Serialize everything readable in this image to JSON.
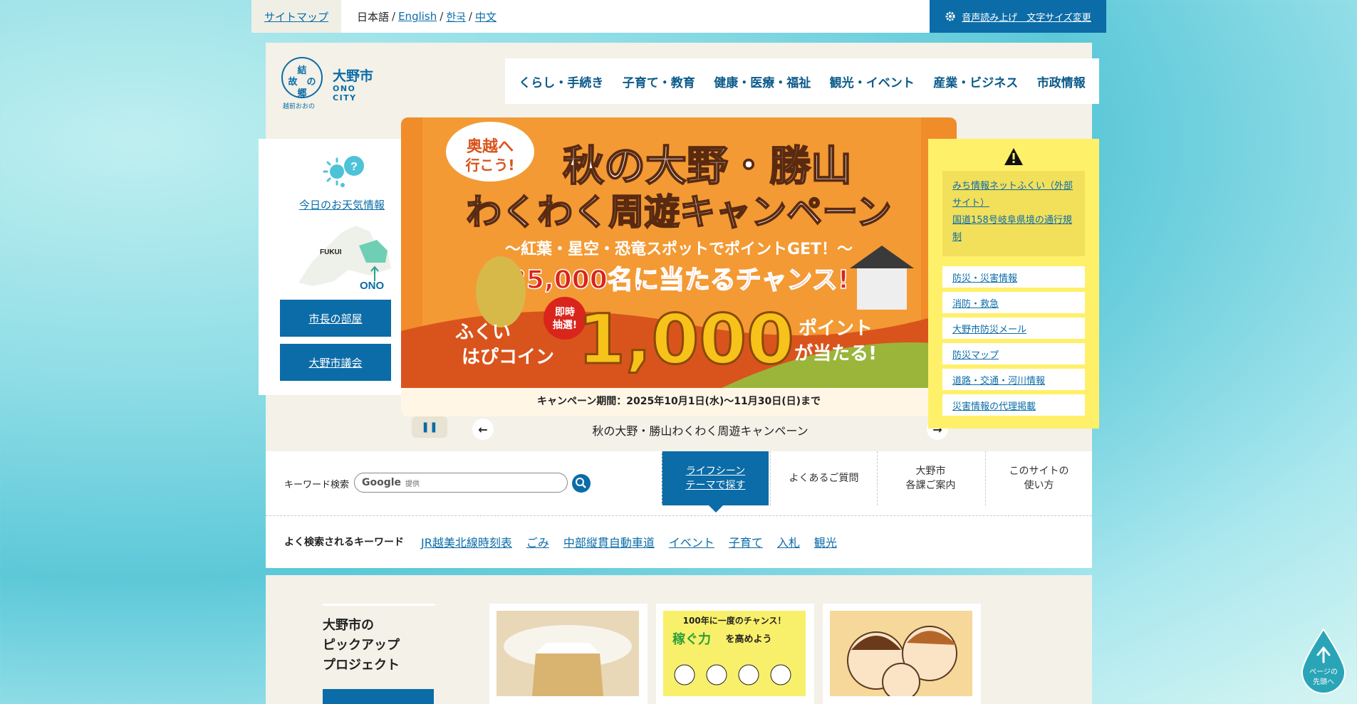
{
  "topbar": {
    "sitemap": "サイトマップ",
    "lang_current": "日本語",
    "langs": [
      "English",
      "한국",
      "中文"
    ],
    "assist": "音声読み上げ　文字サイズ変更"
  },
  "logo": {
    "seal": "結\n故　の\n郷",
    "sub": "越前おおの",
    "name_ja": "大野市",
    "name_en": "ONO CITY"
  },
  "gnav": [
    "くらし・手続き",
    "子育て・教育",
    "健康・医療・福祉",
    "観光・イベント",
    "産業・ビジネス",
    "市政情報"
  ],
  "left": {
    "weather": "今日のお天気情報",
    "map_fukui": "FUKUI",
    "map_ono": "ONO",
    "mayor": "市長の部屋",
    "council": "大野市議会"
  },
  "banner": {
    "tag": "奥越へ\n行こう!",
    "title_1": "秋の大野・勝山",
    "title_2": "わくわく周遊キャンペーン",
    "sub": "〜紅葉・星空・恐竜スポットでポイントGET！〜",
    "chance": "35,000名に当たるチャンス!",
    "instant": "即時\n抽選!",
    "coin": "ふくい\nはぴコイン",
    "points": "1,000",
    "points_tail": "ポイント\nが当たる!",
    "period": "キャンペーン期間：2025年10月1日(水)〜11月30日(日)まで",
    "caption": "秋の大野・勝山わくわく周遊キャンペーン"
  },
  "warn": {
    "notice_1": "みち情報ネットふくい（外部サイト）",
    "notice_2": "国道158号岐阜県境の通行規制",
    "items": [
      "防災・災害情報",
      "消防・救急",
      "大野市防災メール",
      "防災マップ",
      "道路・交通・河川情報",
      "災害情報の代理掲載"
    ]
  },
  "search": {
    "label": "キーワード検索",
    "google": "Google",
    "provided": "提供",
    "tab_life": "ライフシーン\nテーマで探す",
    "tab_faq": "よくあるご質問",
    "tab_dept": "大野市\n各課ご案内",
    "tab_howto": "このサイトの\n使い方"
  },
  "popular": {
    "label": "よく検索されるキーワード",
    "items": [
      "JR越美北線時刻表",
      "ごみ",
      "中部縦貫自動車道",
      "イベント",
      "子育て",
      "入札",
      "観光"
    ]
  },
  "pickup": {
    "title": "大野市の\nピックアップ\nプロジェクト",
    "card2_top": "100年に一度のチャンス！",
    "card2_main": "稼ぐ力",
    "card2_tail": "を高めよう"
  },
  "pagetop": "ページの\n先頭へ",
  "colors": {
    "primary": "#0b6ca8",
    "banner": "#f08c2a",
    "warning": "#fff06a"
  }
}
